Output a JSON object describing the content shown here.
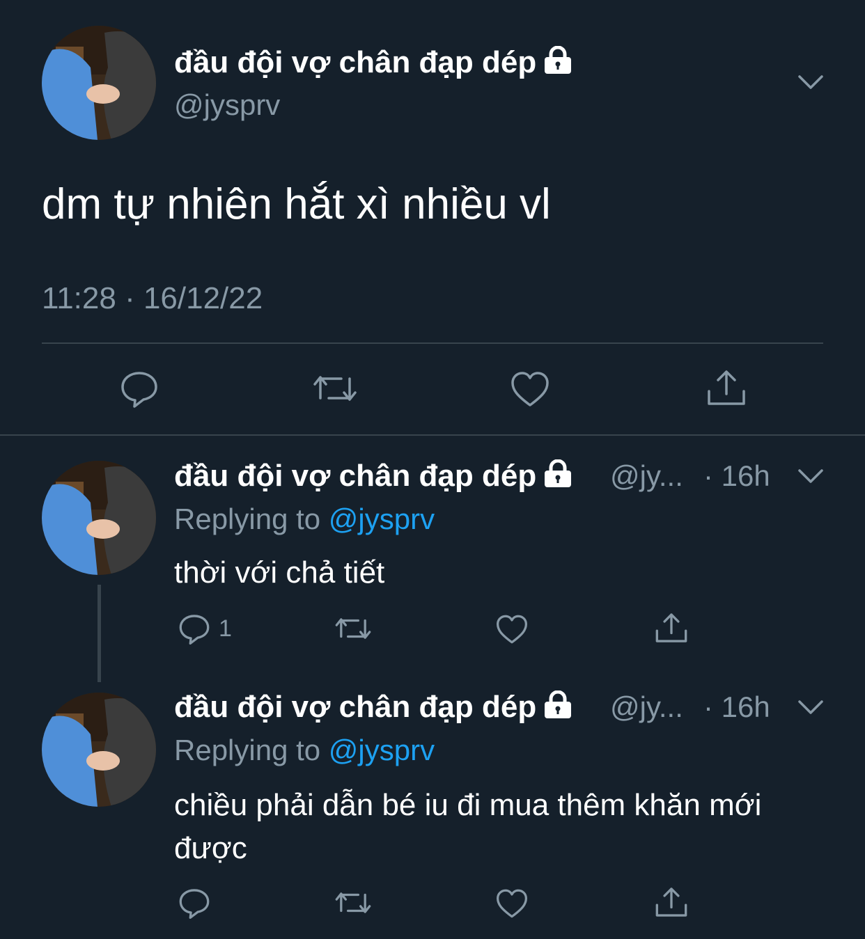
{
  "main_tweet": {
    "display_name": "đầu đội vợ chân đạp dép",
    "handle": "@jysprv",
    "text": "dm tự nhiên hắt xì nhiều vl",
    "timestamp": "11:28 · 16/12/22"
  },
  "replies": [
    {
      "display_name": "đầu đội vợ chân đạp dép",
      "handle_truncated": "@jy...",
      "age": "· 16h",
      "replying_prefix": "Replying to",
      "replying_handle": "@jysprv",
      "text": "thời với chả tiết",
      "reply_count": "1"
    },
    {
      "display_name": "đầu đội vợ chân đạp dép",
      "handle_truncated": "@jy...",
      "age": "· 16h",
      "replying_prefix": "Replying to",
      "replying_handle": "@jysprv",
      "text_line1": "chiều phải dẫn bé iu đi mua thêm khăn mới",
      "text_line2": "được",
      "reply_count": ""
    }
  ],
  "icons": [
    "lock-icon",
    "chevron-down-icon",
    "reply-icon",
    "retweet-icon",
    "like-icon",
    "share-icon"
  ],
  "colors": {
    "background": "#15202b",
    "text": "#ffffff",
    "muted": "#8899a6",
    "link": "#1da1f2",
    "divider": "#38444d"
  }
}
